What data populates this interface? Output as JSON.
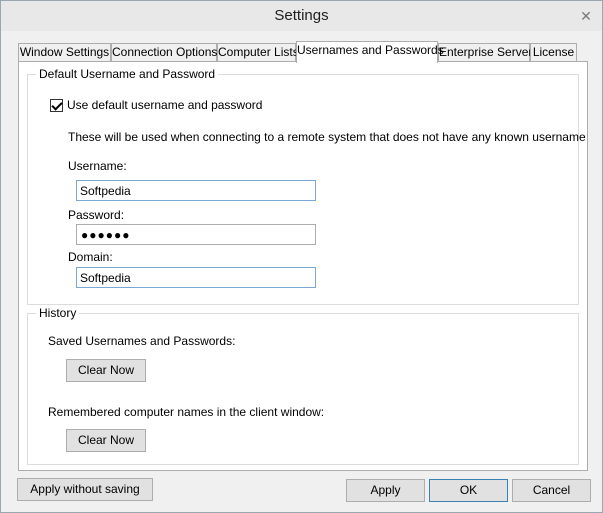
{
  "window": {
    "title": "Settings",
    "close_glyph": "✕"
  },
  "tabs": [
    {
      "label": "Window Settings"
    },
    {
      "label": "Connection Options"
    },
    {
      "label": "Computer Lists"
    },
    {
      "label": "Usernames and Passwords",
      "active": true
    },
    {
      "label": "Enterprise Server"
    },
    {
      "label": "License"
    }
  ],
  "default_group": {
    "legend": "Default Username and Password",
    "checkbox_label": "Use default username and password",
    "checked": true,
    "description": "These will be used when connecting to a remote system that does not have any known username",
    "username_label": "Username:",
    "username_value": "Softpedia",
    "password_label": "Password:",
    "password_dots": "●●●●●●",
    "domain_label": "Domain:",
    "domain_value": "Softpedia"
  },
  "history_group": {
    "legend": "History",
    "saved_label": "Saved Usernames and Passwords:",
    "clear_label_1": "Clear Now",
    "remembered_label": "Remembered computer names in the client window:",
    "clear_label_2": "Clear Now"
  },
  "footer": {
    "apply_without_saving": "Apply without saving",
    "apply": "Apply",
    "ok": "OK",
    "cancel": "Cancel"
  }
}
